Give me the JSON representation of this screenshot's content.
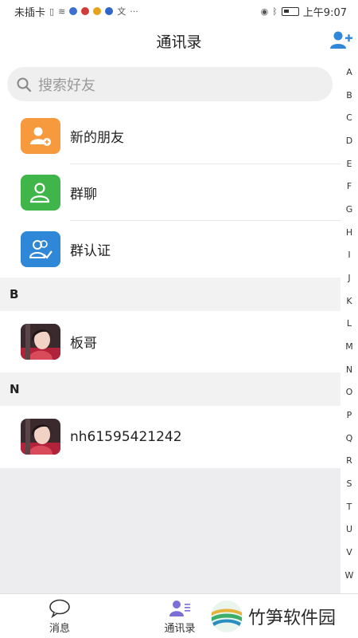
{
  "status_bar": {
    "carrier": "未插卡",
    "time": "上午9:07"
  },
  "header": {
    "title": "通讯录",
    "add_icon": "add-user-icon"
  },
  "search": {
    "placeholder": "搜索好友",
    "icon": "search-icon"
  },
  "functions": [
    {
      "label": "新的朋友",
      "icon": "new-friend-icon",
      "color": "#f79a3e"
    },
    {
      "label": "群聊",
      "icon": "group-chat-icon",
      "color": "#3fb54a"
    },
    {
      "label": "群认证",
      "icon": "group-verify-icon",
      "color": "#2f87d8"
    }
  ],
  "sections": [
    {
      "letter": "B",
      "contacts": [
        {
          "name": "板哥"
        }
      ]
    },
    {
      "letter": "N",
      "contacts": [
        {
          "name": "nh61595421242"
        }
      ]
    }
  ],
  "index_letters": [
    "A",
    "B",
    "C",
    "D",
    "E",
    "F",
    "G",
    "H",
    "I",
    "J",
    "K",
    "L",
    "M",
    "N",
    "O",
    "P",
    "Q",
    "R",
    "S",
    "T",
    "U",
    "V",
    "W"
  ],
  "tabs": [
    {
      "label": "消息",
      "icon": "message-icon"
    },
    {
      "label": "通讯录",
      "icon": "contacts-icon",
      "active": true
    }
  ],
  "watermark": {
    "text": "竹笋软件园"
  },
  "colors": {
    "accent": "#2f87d8",
    "tab_active": "#7a6fd6"
  }
}
